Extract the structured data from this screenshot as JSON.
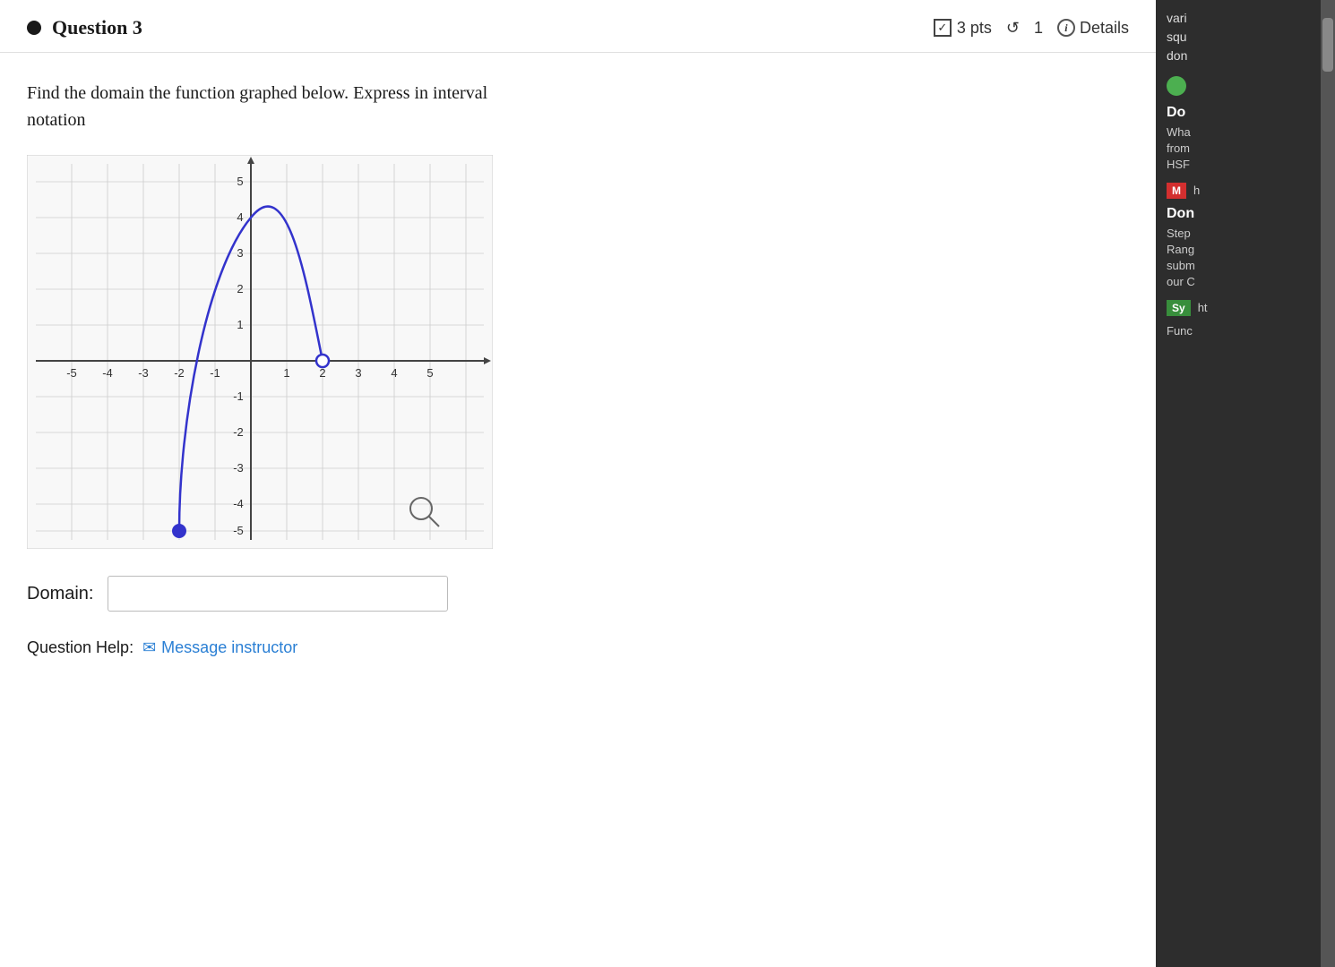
{
  "question": {
    "number": "Question 3",
    "points": "3 pts",
    "history": "1",
    "details_label": "Details",
    "text_line1": "Find the domain the function graphed below. Express in interval",
    "text_line2": "notation",
    "domain_label": "Domain:",
    "domain_placeholder": "",
    "help_label": "Question Help:",
    "message_label": "Message instructor"
  },
  "graph": {
    "x_axis_labels": [
      "-5",
      "-4",
      "-3",
      "-2",
      "-1",
      "1",
      "2",
      "3",
      "4",
      "5"
    ],
    "y_axis_labels": [
      "5",
      "4",
      "3",
      "2",
      "1",
      "-1",
      "-2",
      "-3",
      "-4",
      "-5"
    ]
  },
  "sidebar": {
    "top_text_1": "vari",
    "top_text_2": "squ",
    "top_text_3": "don",
    "section1_label": "Do",
    "section1_text1": "Wha",
    "section1_text2": "from",
    "section1_text3": "HSF",
    "badge1": "M",
    "badge1_suffix": "h",
    "section2_label": "Don",
    "section2_text1": "Step",
    "section2_text2": "Rang",
    "section2_text3": "subm",
    "section2_text4": "our C",
    "badge2": "Sy",
    "badge2_suffix": "ht",
    "bottom_text": "Func"
  }
}
